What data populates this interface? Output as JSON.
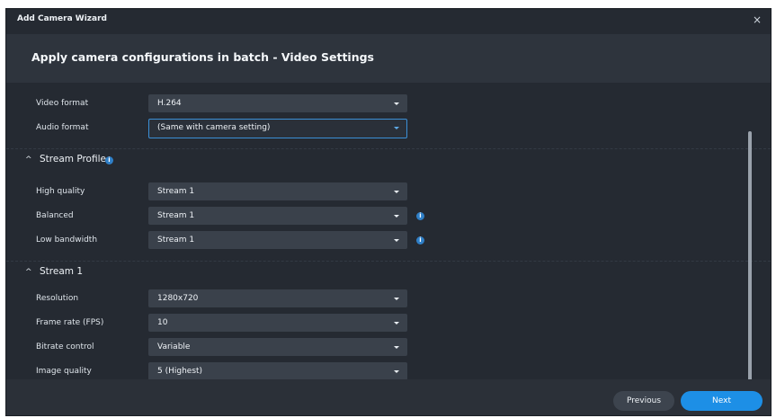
{
  "window": {
    "title": "Add Camera Wizard",
    "close_icon": "×"
  },
  "page": {
    "title": "Apply camera configurations in batch - Video Settings"
  },
  "codec": {
    "video_format": {
      "label": "Video format",
      "value": "H.264"
    },
    "audio_format": {
      "label": "Audio format",
      "value": "(Same with camera setting)"
    }
  },
  "stream_profile": {
    "title": "Stream Profile",
    "chevron": "^",
    "info_icon": "i",
    "high_quality": {
      "label": "High quality",
      "value": "Stream 1"
    },
    "balanced": {
      "label": "Balanced",
      "value": "Stream 1"
    },
    "low_bandwidth": {
      "label": "Low bandwidth",
      "value": "Stream 1"
    }
  },
  "stream1": {
    "title": "Stream 1",
    "chevron": "^",
    "resolution": {
      "label": "Resolution",
      "value": "1280x720"
    },
    "frame_rate": {
      "label": "Frame rate (FPS)",
      "value": "10"
    },
    "bitrate_control": {
      "label": "Bitrate control",
      "value": "Variable"
    },
    "image_quality": {
      "label": "Image quality",
      "value": "5 (Highest)"
    }
  },
  "footer": {
    "previous_label": "Previous",
    "next_label": "Next"
  },
  "colors": {
    "dialog_bg": "#252a32",
    "accent": "#1d8fe6",
    "focus_border": "#3b8fd6",
    "info_icon": "#2f7fc7"
  }
}
